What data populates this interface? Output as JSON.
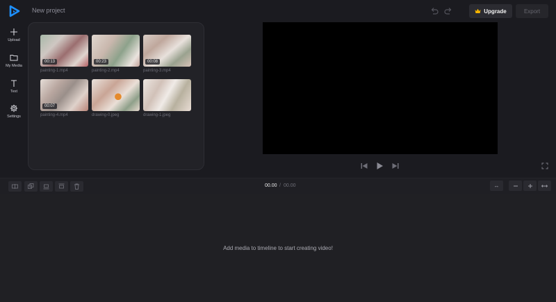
{
  "header": {
    "project_title": "New project",
    "upgrade_label": "Upgrade",
    "export_label": "Export",
    "accent_color": "#1e90ff"
  },
  "sidebar": {
    "items": [
      {
        "label": "Upload",
        "icon": "plus-icon"
      },
      {
        "label": "My Media",
        "icon": "folder-icon"
      },
      {
        "label": "Text",
        "icon": "text-icon"
      },
      {
        "label": "Settings",
        "icon": "gear-icon"
      }
    ]
  },
  "media": {
    "items": [
      {
        "name": "painting-1.mp4",
        "duration": "00:13"
      },
      {
        "name": "painting-2.mp4",
        "duration": "00:23"
      },
      {
        "name": "painting-3.mp4",
        "duration": "00:08"
      },
      {
        "name": "painting-4.mp4",
        "duration": "00:07"
      },
      {
        "name": "drawing-0.jpeg",
        "duration": ""
      },
      {
        "name": "drawing-1.jpeg",
        "duration": ""
      }
    ]
  },
  "timeline": {
    "current_time": "00.00",
    "separator": "/",
    "total_time": "00.00",
    "empty_message": "Add media to timeline to start creating video!",
    "zoom_fit_label": "↔"
  }
}
